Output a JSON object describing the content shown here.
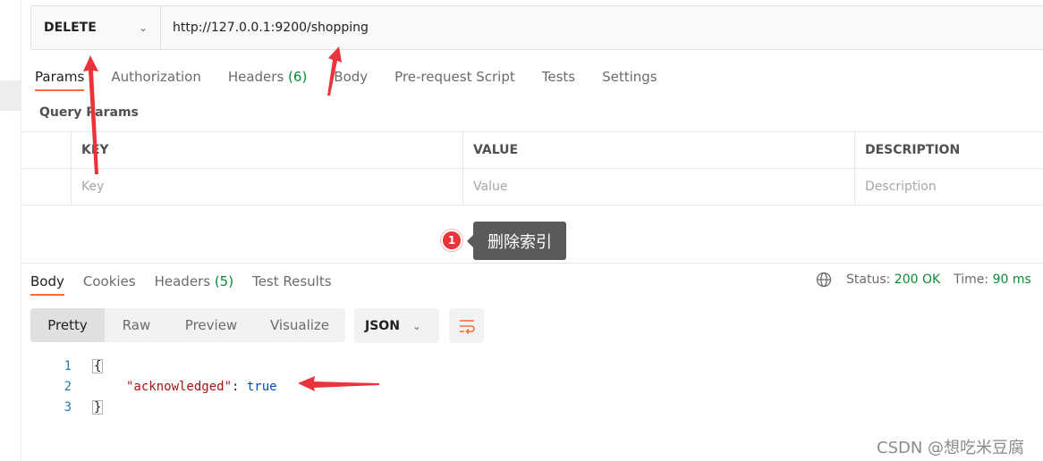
{
  "request": {
    "method": "DELETE",
    "url": "http://127.0.0.1:9200/shopping"
  },
  "request_tabs": [
    {
      "label": "Params",
      "active": true
    },
    {
      "label": "Authorization"
    },
    {
      "label": "Headers",
      "count": "(6)"
    },
    {
      "label": "Body"
    },
    {
      "label": "Pre-request Script"
    },
    {
      "label": "Tests"
    },
    {
      "label": "Settings"
    }
  ],
  "query_params": {
    "title": "Query Params",
    "columns": [
      "KEY",
      "VALUE",
      "DESCRIPTION"
    ],
    "placeholders": [
      "Key",
      "Value",
      "Description"
    ]
  },
  "annotation": {
    "badge": "1",
    "tooltip": "删除索引",
    "arrow_color": "#e8343a"
  },
  "response_tabs": [
    {
      "label": "Body",
      "active": true
    },
    {
      "label": "Cookies"
    },
    {
      "label": "Headers",
      "count": "(5)"
    },
    {
      "label": "Test Results"
    }
  ],
  "response_meta": {
    "icon": "globe-icon",
    "status_label": "Status:",
    "status_value": "200 OK",
    "time_label": "Time:",
    "time_value": "90 ms",
    "overflow": "S"
  },
  "view_modes": [
    "Pretty",
    "Raw",
    "Preview",
    "Visualize"
  ],
  "format": "JSON",
  "code": {
    "line_numbers": [
      "1",
      "2",
      "3"
    ],
    "open_brace": "{",
    "key": "\"acknowledged\"",
    "colon": ": ",
    "value": "true",
    "close_brace": "}"
  },
  "watermark": "CSDN @想吃米豆腐",
  "colors": {
    "accent": "#ff6c37",
    "success": "#0a8a3a"
  }
}
